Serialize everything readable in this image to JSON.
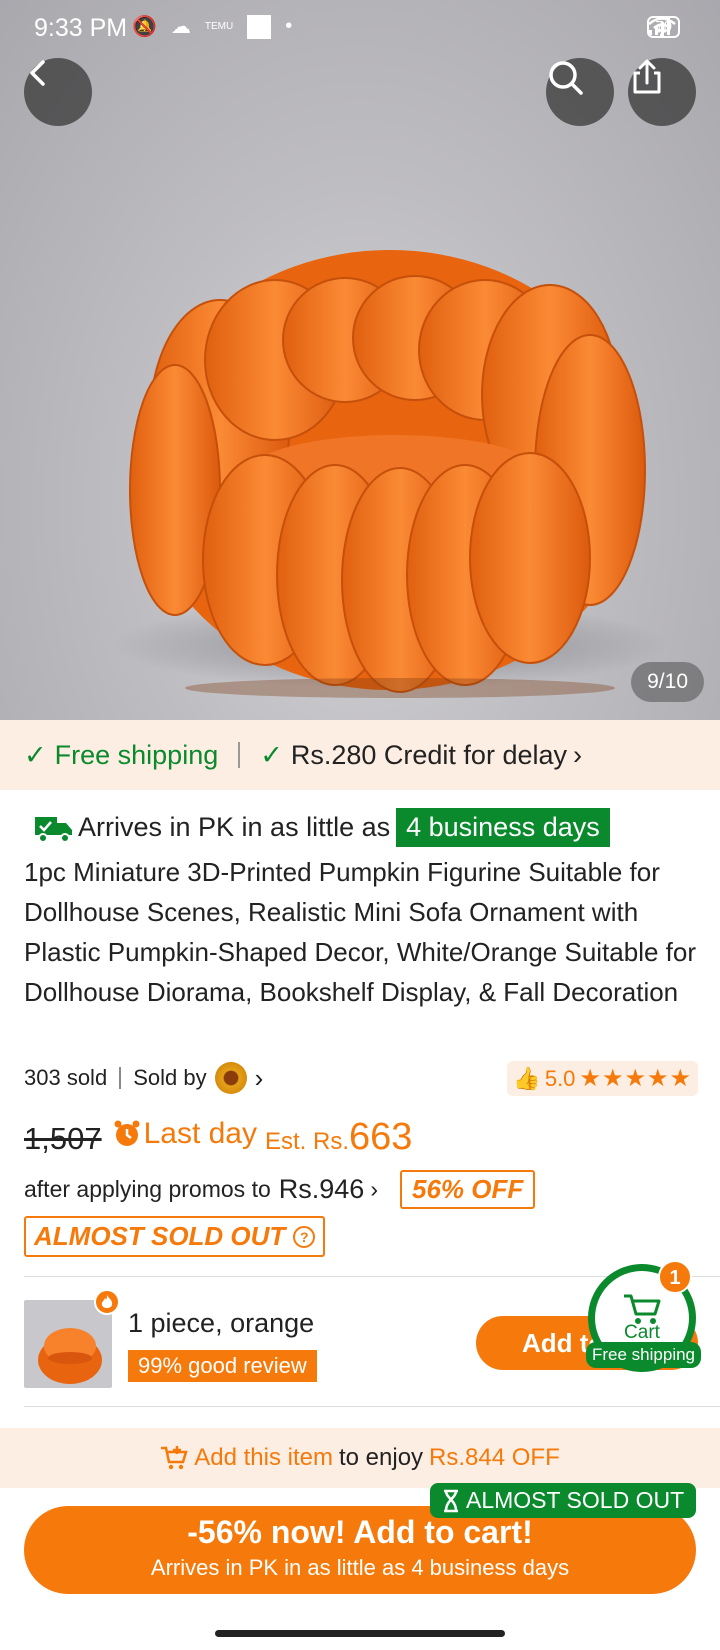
{
  "status_bar": {
    "time": "9:33 PM",
    "temu_label": "TEMU",
    "battery": "70"
  },
  "hero": {
    "image_counter": "9/10",
    "back_icon": "back-arrow-icon",
    "search_icon": "search-icon",
    "share_icon": "share-icon"
  },
  "shipping_strip": {
    "free_shipping": "Free shipping",
    "credit": "Rs.280 Credit for delay"
  },
  "delivery": {
    "prefix": "Arrives in PK in as little as",
    "days": "4 business days"
  },
  "product": {
    "title": "1pc Miniature 3D-Printed Pumpkin Figurine Suitable for Dollhouse Scenes, Realistic Mini Sofa Ornament with Plastic Pumpkin-Shaped Decor, White/Orange Suitable for Dollhouse Diorama, Bookshelf Display, & Fall Decoration",
    "sold_count": "303 sold",
    "sold_by": "Sold by",
    "rating": "5.0",
    "stars": 5
  },
  "price": {
    "original": "1,507",
    "last_day": "Last day",
    "est_label": "Est. Rs.",
    "est_value": "663",
    "promo_text": "after applying promos to",
    "promo_price": "Rs.946",
    "discount": "56% OFF",
    "almost_sold_out": "ALMOST SOLD OUT"
  },
  "variant": {
    "label": "1 piece, orange",
    "good_review": "99% good review",
    "add_button": "Add to cart"
  },
  "cart": {
    "label": "Cart",
    "count": "1",
    "free_shipping": "Free shipping"
  },
  "promo_strip": {
    "add_item": "Add this item",
    "to_enjoy": "to enjoy",
    "saving": "Rs.844 OFF"
  },
  "cta": {
    "soldout_tag": "ALMOST SOLD OUT",
    "main": "-56% now! Add to cart!",
    "sub": "Arrives in PK in as little as 4 business days"
  },
  "colors": {
    "accent_orange": "#f57a0b",
    "success_green": "#0a8a2d",
    "promo_bg": "#fdeee3"
  }
}
